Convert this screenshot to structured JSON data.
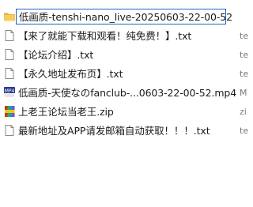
{
  "files": [
    {
      "name": "低画质-tenshi-nano_live-20250603-22-00-52",
      "type": "",
      "icon": "folder-icon",
      "editing": true
    },
    {
      "name": "【来了就能下载和观看！纯免费！】.txt",
      "type": "te",
      "icon": "text-file-icon"
    },
    {
      "name": "【论坛介绍】.txt",
      "type": "te",
      "icon": "text-file-icon"
    },
    {
      "name": "【永久地址发布页】.txt",
      "type": "te",
      "icon": "text-file-icon"
    },
    {
      "name": "低画质-天使なのfanclub-...0603-22-00-52.mp4",
      "type": "M",
      "icon": "mp4-file-icon"
    },
    {
      "name": "上老王论坛当老王.zip",
      "type": "zi",
      "icon": "zip-file-icon"
    },
    {
      "name": "最新地址及APP请发邮箱自动获取！！！.txt",
      "type": "te",
      "icon": "text-file-icon"
    }
  ],
  "colors": {
    "folder": "#f2c14e",
    "edit_border": "#1e64c8"
  }
}
